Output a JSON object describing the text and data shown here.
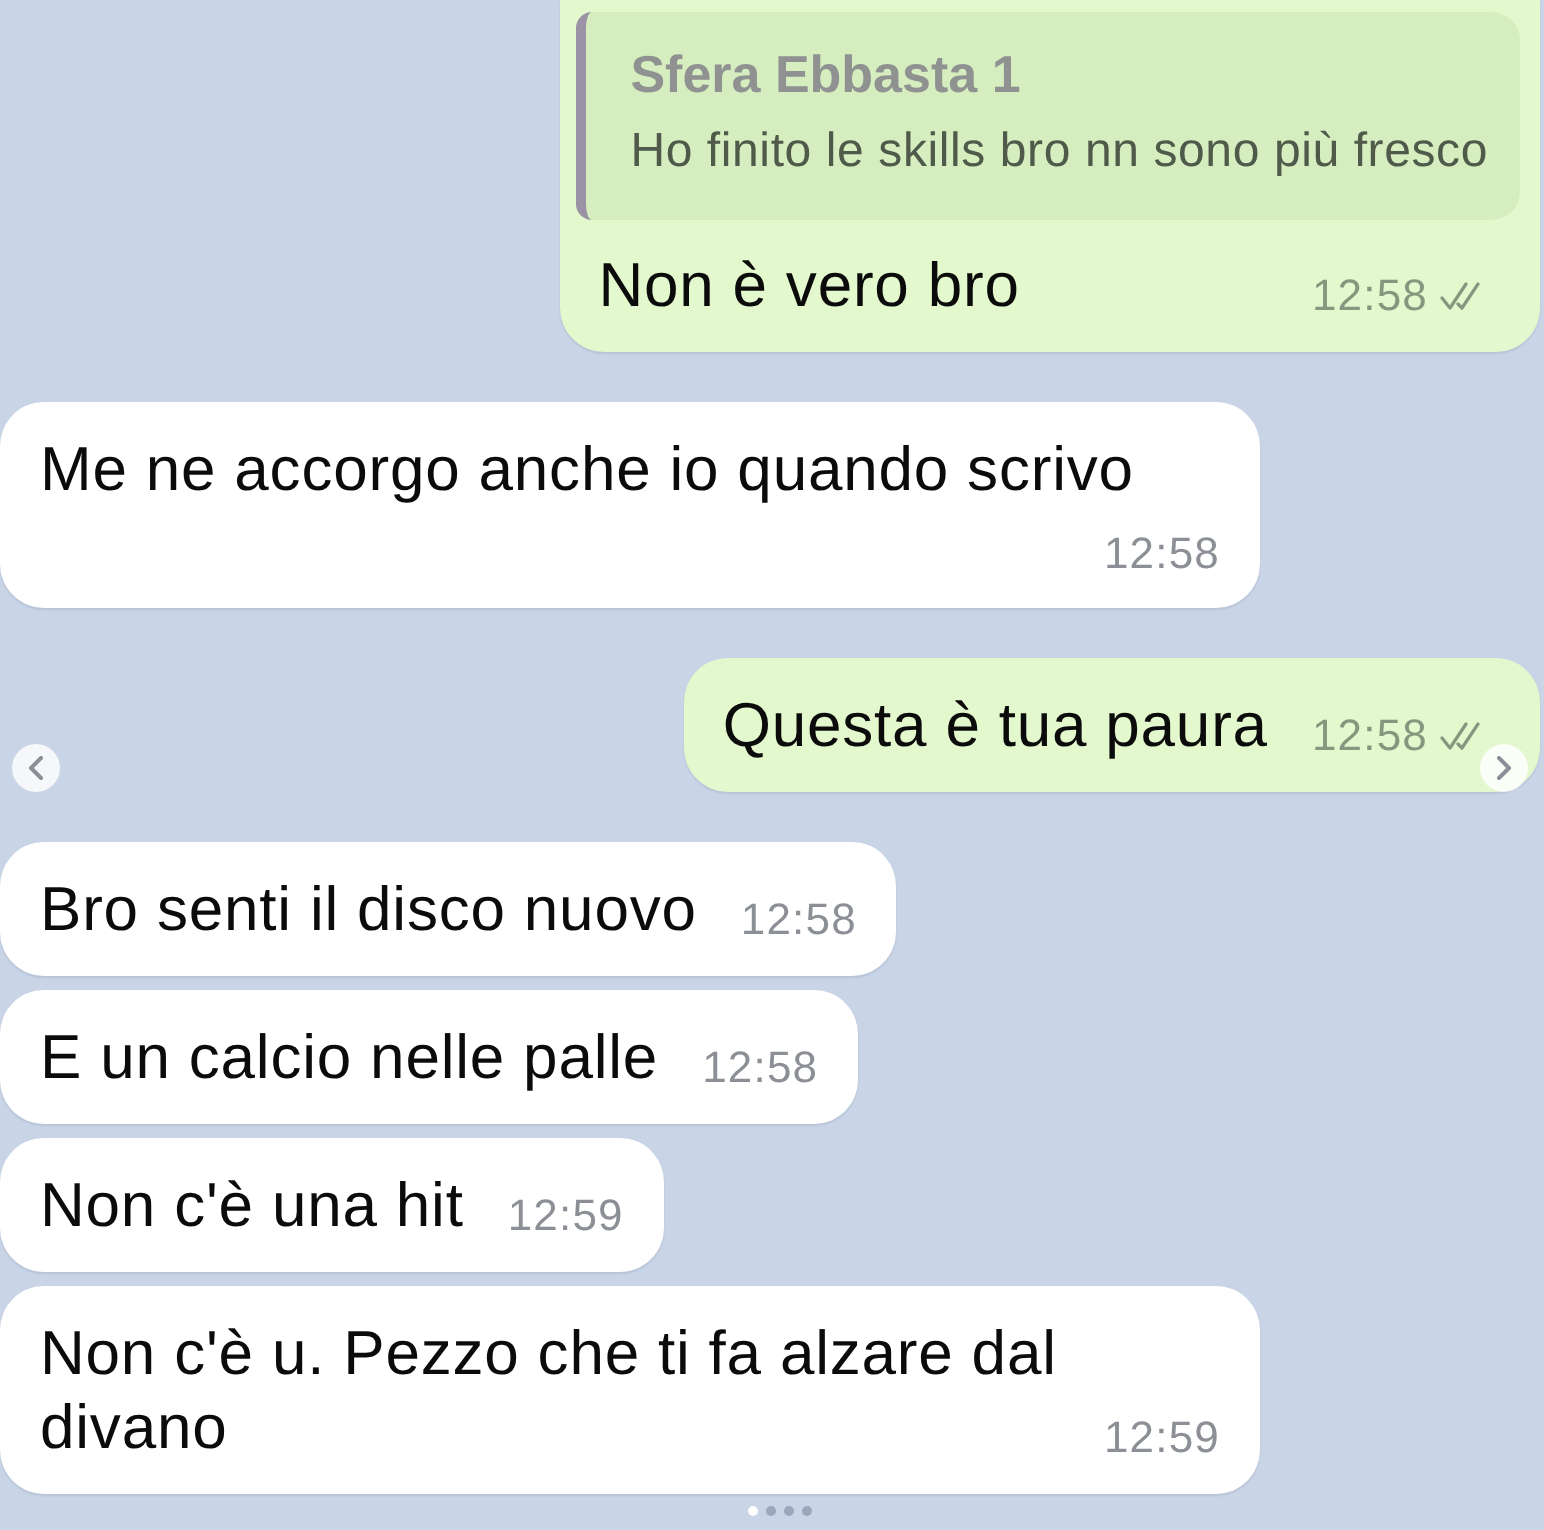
{
  "messages": [
    {
      "kind": "outgoing",
      "reply": {
        "sender": "Sfera Ebbasta 1",
        "text": "Ho finito le skills bro nn sono più fresco"
      },
      "text": "Non è vero bro",
      "time": "12:58",
      "read": true
    },
    {
      "kind": "incoming",
      "text": "Me ne accorgo anche io quando scrivo",
      "time": "12:58"
    },
    {
      "kind": "outgoing",
      "text": "Questa è tua paura",
      "time": "12:58",
      "read": true
    },
    {
      "kind": "incoming",
      "text": "Bro senti il disco nuovo",
      "time": "12:58"
    },
    {
      "kind": "incoming",
      "text": "E un calcio nelle palle",
      "time": "12:58"
    },
    {
      "kind": "incoming",
      "text": "Non c'è una hit",
      "time": "12:59"
    },
    {
      "kind": "incoming",
      "text": "Non c'è u. Pezzo che ti fa alzare dal divano",
      "time": "12:59"
    }
  ],
  "carousel": {
    "has_previous": true,
    "has_next": true,
    "pages": [
      {
        "selected": true
      },
      {
        "selected": false
      },
      {
        "selected": false
      },
      {
        "selected": false
      }
    ]
  }
}
